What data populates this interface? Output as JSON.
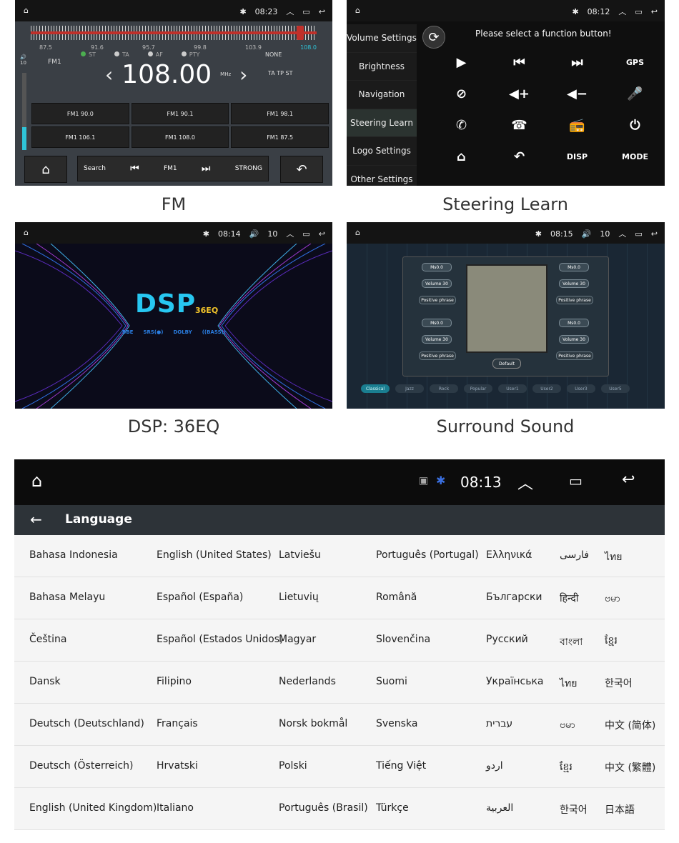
{
  "panels": {
    "fm": {
      "caption": "FM",
      "time": "08:23",
      "scale_ticks": [
        "87.5",
        "91.6",
        "95.7",
        "99.8",
        "103.9",
        "108.0"
      ],
      "flags": [
        "ST",
        "TA",
        "AF",
        "PTY"
      ],
      "none_label": "NONE",
      "band": "FM1",
      "volume_level": "10",
      "frequency": "108.00",
      "unit": "MHz",
      "ta_tp": "TA TP ST",
      "presets": [
        "FM1 90.0",
        "FM1 90.1",
        "FM1 98.1",
        "FM1 106.1",
        "FM1 108.0",
        "FM1 87.5"
      ],
      "search_label": "Search",
      "band_label": "FM1",
      "strong_label": "STRONG"
    },
    "steering": {
      "caption": "Steering Learn",
      "time": "08:12",
      "menu": [
        "Volume Settings",
        "Brightness",
        "Navigation",
        "Steering Learn",
        "Logo Settings",
        "Other Settings"
      ],
      "active_item": "Steering Learn",
      "prompt": "Please select a function button!",
      "buttons": [
        {
          "name": "play-icon",
          "label": "▶"
        },
        {
          "name": "prev-track-icon",
          "label": "⏮"
        },
        {
          "name": "next-track-icon",
          "label": "⏭"
        },
        {
          "name": "gps-button",
          "label": "GPS"
        },
        {
          "name": "mute-icon",
          "label": "⊘"
        },
        {
          "name": "volume-up-icon",
          "label": "◀+"
        },
        {
          "name": "volume-down-icon",
          "label": "◀−"
        },
        {
          "name": "microphone-icon",
          "label": "🎤"
        },
        {
          "name": "phone-icon",
          "label": "✆"
        },
        {
          "name": "hang-up-icon",
          "label": "☎"
        },
        {
          "name": "radio-icon",
          "label": "📻"
        },
        {
          "name": "power-icon",
          "label": "⏻"
        },
        {
          "name": "home-icon",
          "label": "⌂"
        },
        {
          "name": "back-icon",
          "label": "↶"
        },
        {
          "name": "disp-button",
          "label": "DISP"
        },
        {
          "name": "mode-button",
          "label": "MODE"
        }
      ]
    },
    "dsp": {
      "caption": "DSP: 36EQ",
      "time": "08:14",
      "volume": "10",
      "title": "DSP",
      "subtitle": "36EQ",
      "logos": [
        "BBE",
        "SRS(●)",
        "DOLBY",
        "((BASS))"
      ]
    },
    "surround": {
      "caption": "Surround Sound",
      "time": "08:15",
      "volume": "10",
      "ms_label": "Ms0.0",
      "volume_label": "Volume 30",
      "phrase_label": "Positive phrase",
      "default_label": "Default",
      "presets": [
        "Classical",
        "Jazz",
        "Rock",
        "Popular",
        "User1",
        "User2",
        "User3",
        "User5"
      ],
      "active_preset": "Classical"
    }
  },
  "language": {
    "time": "08:13",
    "title": "Language",
    "rows": [
      [
        "Bahasa Indonesia",
        "English (United States)",
        "Latviešu",
        "Português (Portugal)",
        "Ελληνικά",
        "فارسی",
        "ไทย"
      ],
      [
        "Bahasa Melayu",
        "Español (España)",
        "Lietuvių",
        "Română",
        "Български",
        "हिन्दी",
        "ဗမာ"
      ],
      [
        "Čeština",
        "Español (Estados Unidos)",
        "Magyar",
        "Slovenčina",
        "Русский",
        "বাংলা",
        "ខ្មែរ"
      ],
      [
        "Dansk",
        "Filipino",
        "Nederlands",
        "Suomi",
        "Українська",
        "ไทย",
        "한국어"
      ],
      [
        "Deutsch (Deutschland)",
        "Français",
        "Norsk bokmål",
        "Svenska",
        "עברית",
        "ဗမာ",
        "中文 (简体)"
      ],
      [
        "Deutsch (Österreich)",
        "Hrvatski",
        "Polski",
        "Tiếng Việt",
        "اردو",
        "ខ្មែរ",
        "中文 (繁體)"
      ],
      [
        "English (United Kingdom)",
        "Italiano",
        "Português (Brasil)",
        "Türkçe",
        "العربية",
        "한국어",
        "日本語"
      ]
    ]
  }
}
